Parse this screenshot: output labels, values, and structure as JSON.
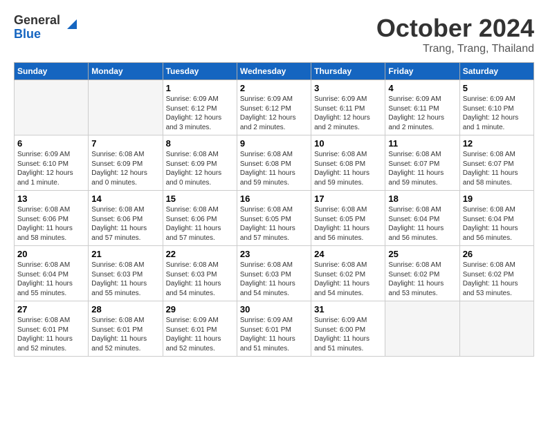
{
  "header": {
    "logo_general": "General",
    "logo_blue": "Blue",
    "month_title": "October 2024",
    "location": "Trang, Trang, Thailand"
  },
  "weekdays": [
    "Sunday",
    "Monday",
    "Tuesday",
    "Wednesday",
    "Thursday",
    "Friday",
    "Saturday"
  ],
  "weeks": [
    [
      {
        "day": "",
        "empty": true
      },
      {
        "day": "",
        "empty": true
      },
      {
        "day": "1",
        "sunrise": "Sunrise: 6:09 AM",
        "sunset": "Sunset: 6:12 PM",
        "daylight": "Daylight: 12 hours and 3 minutes."
      },
      {
        "day": "2",
        "sunrise": "Sunrise: 6:09 AM",
        "sunset": "Sunset: 6:12 PM",
        "daylight": "Daylight: 12 hours and 2 minutes."
      },
      {
        "day": "3",
        "sunrise": "Sunrise: 6:09 AM",
        "sunset": "Sunset: 6:11 PM",
        "daylight": "Daylight: 12 hours and 2 minutes."
      },
      {
        "day": "4",
        "sunrise": "Sunrise: 6:09 AM",
        "sunset": "Sunset: 6:11 PM",
        "daylight": "Daylight: 12 hours and 2 minutes."
      },
      {
        "day": "5",
        "sunrise": "Sunrise: 6:09 AM",
        "sunset": "Sunset: 6:10 PM",
        "daylight": "Daylight: 12 hours and 1 minute."
      }
    ],
    [
      {
        "day": "6",
        "sunrise": "Sunrise: 6:09 AM",
        "sunset": "Sunset: 6:10 PM",
        "daylight": "Daylight: 12 hours and 1 minute."
      },
      {
        "day": "7",
        "sunrise": "Sunrise: 6:08 AM",
        "sunset": "Sunset: 6:09 PM",
        "daylight": "Daylight: 12 hours and 0 minutes."
      },
      {
        "day": "8",
        "sunrise": "Sunrise: 6:08 AM",
        "sunset": "Sunset: 6:09 PM",
        "daylight": "Daylight: 12 hours and 0 minutes."
      },
      {
        "day": "9",
        "sunrise": "Sunrise: 6:08 AM",
        "sunset": "Sunset: 6:08 PM",
        "daylight": "Daylight: 11 hours and 59 minutes."
      },
      {
        "day": "10",
        "sunrise": "Sunrise: 6:08 AM",
        "sunset": "Sunset: 6:08 PM",
        "daylight": "Daylight: 11 hours and 59 minutes."
      },
      {
        "day": "11",
        "sunrise": "Sunrise: 6:08 AM",
        "sunset": "Sunset: 6:07 PM",
        "daylight": "Daylight: 11 hours and 59 minutes."
      },
      {
        "day": "12",
        "sunrise": "Sunrise: 6:08 AM",
        "sunset": "Sunset: 6:07 PM",
        "daylight": "Daylight: 11 hours and 58 minutes."
      }
    ],
    [
      {
        "day": "13",
        "sunrise": "Sunrise: 6:08 AM",
        "sunset": "Sunset: 6:06 PM",
        "daylight": "Daylight: 11 hours and 58 minutes."
      },
      {
        "day": "14",
        "sunrise": "Sunrise: 6:08 AM",
        "sunset": "Sunset: 6:06 PM",
        "daylight": "Daylight: 11 hours and 57 minutes."
      },
      {
        "day": "15",
        "sunrise": "Sunrise: 6:08 AM",
        "sunset": "Sunset: 6:06 PM",
        "daylight": "Daylight: 11 hours and 57 minutes."
      },
      {
        "day": "16",
        "sunrise": "Sunrise: 6:08 AM",
        "sunset": "Sunset: 6:05 PM",
        "daylight": "Daylight: 11 hours and 57 minutes."
      },
      {
        "day": "17",
        "sunrise": "Sunrise: 6:08 AM",
        "sunset": "Sunset: 6:05 PM",
        "daylight": "Daylight: 11 hours and 56 minutes."
      },
      {
        "day": "18",
        "sunrise": "Sunrise: 6:08 AM",
        "sunset": "Sunset: 6:04 PM",
        "daylight": "Daylight: 11 hours and 56 minutes."
      },
      {
        "day": "19",
        "sunrise": "Sunrise: 6:08 AM",
        "sunset": "Sunset: 6:04 PM",
        "daylight": "Daylight: 11 hours and 56 minutes."
      }
    ],
    [
      {
        "day": "20",
        "sunrise": "Sunrise: 6:08 AM",
        "sunset": "Sunset: 6:04 PM",
        "daylight": "Daylight: 11 hours and 55 minutes."
      },
      {
        "day": "21",
        "sunrise": "Sunrise: 6:08 AM",
        "sunset": "Sunset: 6:03 PM",
        "daylight": "Daylight: 11 hours and 55 minutes."
      },
      {
        "day": "22",
        "sunrise": "Sunrise: 6:08 AM",
        "sunset": "Sunset: 6:03 PM",
        "daylight": "Daylight: 11 hours and 54 minutes."
      },
      {
        "day": "23",
        "sunrise": "Sunrise: 6:08 AM",
        "sunset": "Sunset: 6:03 PM",
        "daylight": "Daylight: 11 hours and 54 minutes."
      },
      {
        "day": "24",
        "sunrise": "Sunrise: 6:08 AM",
        "sunset": "Sunset: 6:02 PM",
        "daylight": "Daylight: 11 hours and 54 minutes."
      },
      {
        "day": "25",
        "sunrise": "Sunrise: 6:08 AM",
        "sunset": "Sunset: 6:02 PM",
        "daylight": "Daylight: 11 hours and 53 minutes."
      },
      {
        "day": "26",
        "sunrise": "Sunrise: 6:08 AM",
        "sunset": "Sunset: 6:02 PM",
        "daylight": "Daylight: 11 hours and 53 minutes."
      }
    ],
    [
      {
        "day": "27",
        "sunrise": "Sunrise: 6:08 AM",
        "sunset": "Sunset: 6:01 PM",
        "daylight": "Daylight: 11 hours and 52 minutes."
      },
      {
        "day": "28",
        "sunrise": "Sunrise: 6:08 AM",
        "sunset": "Sunset: 6:01 PM",
        "daylight": "Daylight: 11 hours and 52 minutes."
      },
      {
        "day": "29",
        "sunrise": "Sunrise: 6:09 AM",
        "sunset": "Sunset: 6:01 PM",
        "daylight": "Daylight: 11 hours and 52 minutes."
      },
      {
        "day": "30",
        "sunrise": "Sunrise: 6:09 AM",
        "sunset": "Sunset: 6:01 PM",
        "daylight": "Daylight: 11 hours and 51 minutes."
      },
      {
        "day": "31",
        "sunrise": "Sunrise: 6:09 AM",
        "sunset": "Sunset: 6:00 PM",
        "daylight": "Daylight: 11 hours and 51 minutes."
      },
      {
        "day": "",
        "empty": true
      },
      {
        "day": "",
        "empty": true
      }
    ]
  ]
}
